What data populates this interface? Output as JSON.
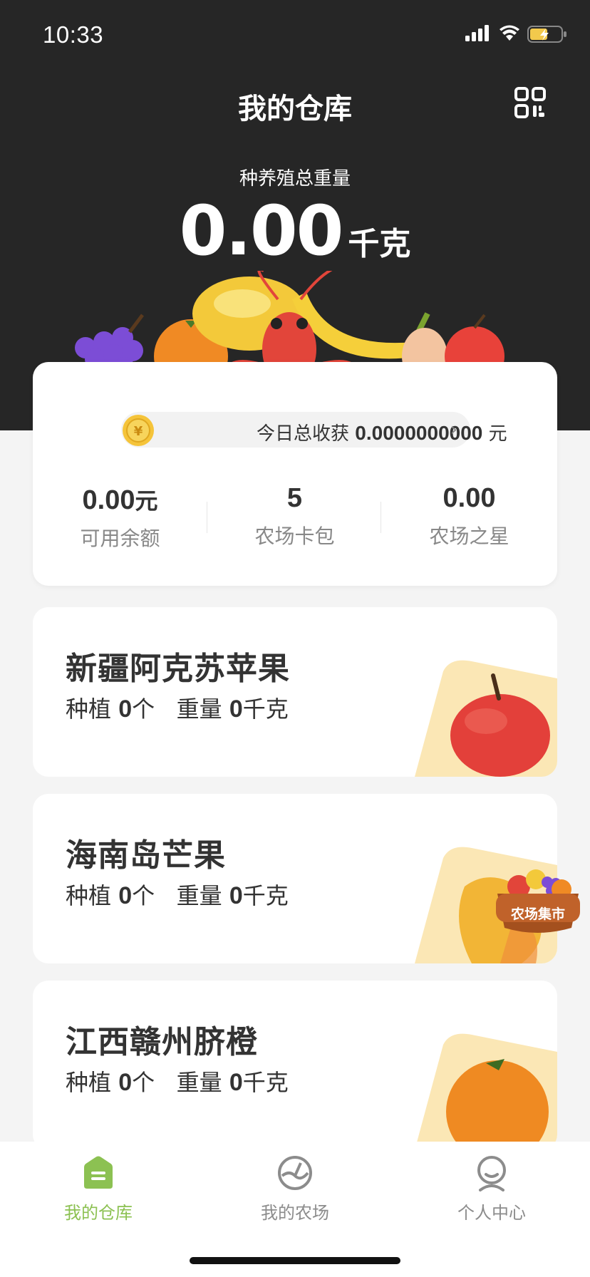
{
  "status_bar": {
    "time": "10:33"
  },
  "header": {
    "title": "我的仓库",
    "weight_label": "种养殖总重量",
    "weight_value": "0.00",
    "weight_unit": "千克"
  },
  "summary": {
    "harvest_prefix": "今日总收获",
    "harvest_amount": "0.0000000000",
    "harvest_unit": "元",
    "stats": [
      {
        "value": "0.00",
        "unit": "元",
        "label": "可用余额"
      },
      {
        "value": "5",
        "unit": "",
        "label": "农场卡包"
      },
      {
        "value": "0.00",
        "unit": "",
        "label": "农场之星"
      }
    ]
  },
  "products": [
    {
      "name": "新疆阿克苏苹果",
      "plant_label": "种植",
      "plant_count": "0",
      "plant_unit": "个",
      "weight_label": "重量",
      "weight": "0",
      "weight_unit": "千克",
      "art": "apple-icon"
    },
    {
      "name": "海南岛芒果",
      "plant_label": "种植",
      "plant_count": "0",
      "plant_unit": "个",
      "weight_label": "重量",
      "weight": "0",
      "weight_unit": "千克",
      "art": "mango-icon"
    },
    {
      "name": "江西赣州脐橙",
      "plant_label": "种植",
      "plant_count": "0",
      "plant_unit": "个",
      "weight_label": "重量",
      "weight": "0",
      "weight_unit": "千克",
      "art": "orange-icon"
    }
  ],
  "market_badge": {
    "label": "农场集市"
  },
  "tabs": [
    {
      "label": "我的仓库",
      "active": true,
      "icon": "warehouse-icon"
    },
    {
      "label": "我的农场",
      "active": false,
      "icon": "farm-icon"
    },
    {
      "label": "个人中心",
      "active": false,
      "icon": "user-icon"
    }
  ],
  "colors": {
    "header_bg": "#262626",
    "page_bg": "#f4f4f4",
    "accent_green": "#8cc152",
    "text_primary": "#333333",
    "text_secondary": "#888888"
  }
}
